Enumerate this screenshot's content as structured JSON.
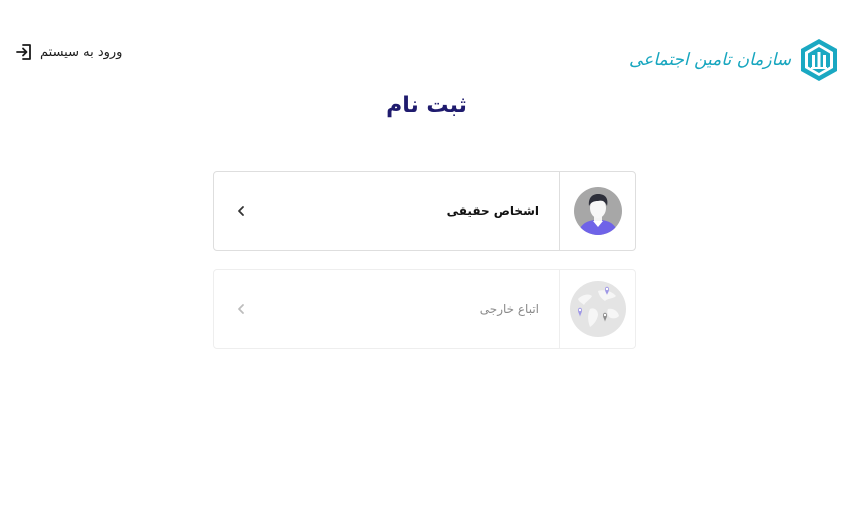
{
  "header": {
    "org_name": "سازمان تامین اجتماعی",
    "login_label": "ورود به سیستم"
  },
  "main": {
    "title": "ثبت نام",
    "options": [
      {
        "label": "اشخاص حقیقی",
        "icon": "person-avatar-icon",
        "enabled": true
      },
      {
        "label": "اتباع خارجی",
        "icon": "world-map-icon",
        "enabled": false
      }
    ]
  },
  "colors": {
    "title": "#1f1b6e",
    "brand": "#17a6bf",
    "avatar_shirt": "#6f63e8",
    "avatar_bg": "#a7a7a7"
  }
}
